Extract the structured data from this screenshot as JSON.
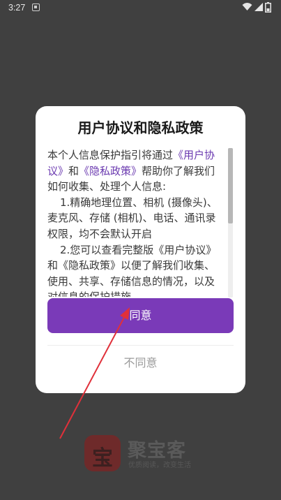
{
  "status_bar": {
    "time": "3:27",
    "icons": [
      "notification-icon",
      "wifi-icon",
      "signal-icon",
      "battery-icon"
    ]
  },
  "background": {
    "brand": {
      "logo_char": "宝",
      "name": "聚宝客",
      "slogan": "优质阅读，改变生活"
    }
  },
  "dialog": {
    "title": "用户协议和隐私政策",
    "content": {
      "intro_1": "本个人信息保护指引将通过",
      "link_user_agreement": "《用户协议》",
      "intro_and": "和",
      "link_privacy": "《隐私政策》",
      "intro_2": "帮助你了解我们如何收集、处理个人信息:",
      "point_1": "1.精确地理位置、相机 (摄像头)、麦克风、存储 (相机)、电话、通讯录权限，均不会默认开启",
      "point_2": "2.您可以查看完整版《用户协议》和《隐私政策》以便了解我们收集、使用、共享、存储信息的情况，以及对信息的保护措施。"
    },
    "agree_label": "同意",
    "disagree_label": "不同意"
  },
  "colors": {
    "accent": "#7a3ab8",
    "link": "#6b3ab0",
    "annotation_arrow": "#e0303a"
  }
}
